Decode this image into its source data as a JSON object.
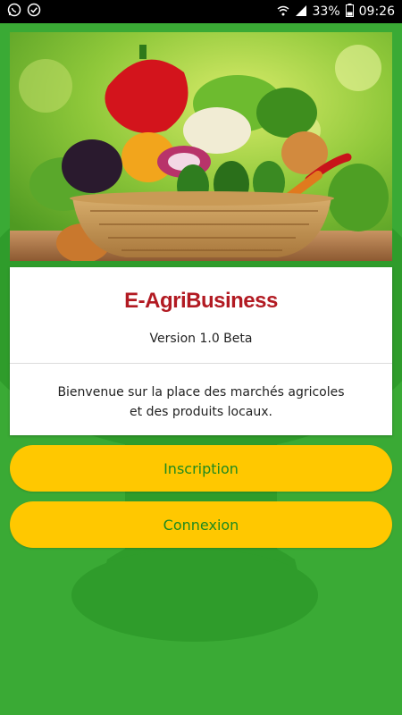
{
  "status_bar": {
    "time": "09:26",
    "battery_percent": "33%",
    "icons": [
      "whatsapp-icon",
      "check-circle-icon",
      "wifi-icon",
      "signal-icon",
      "battery-icon"
    ]
  },
  "colors": {
    "background": "#3aaa35",
    "background_shape": "#2f9c2b",
    "button": "#ffc800",
    "button_text": "#1f8a1f",
    "logo": "#b21a22"
  },
  "card": {
    "logo_text": "E-AgriBusiness",
    "version": "Version 1.0 Beta",
    "welcome_line1": "Bienvenue sur la place des marchés agricoles",
    "welcome_line2": "et des produits locaux."
  },
  "buttons": {
    "signup_label": "Inscription",
    "login_label": "Connexion"
  }
}
